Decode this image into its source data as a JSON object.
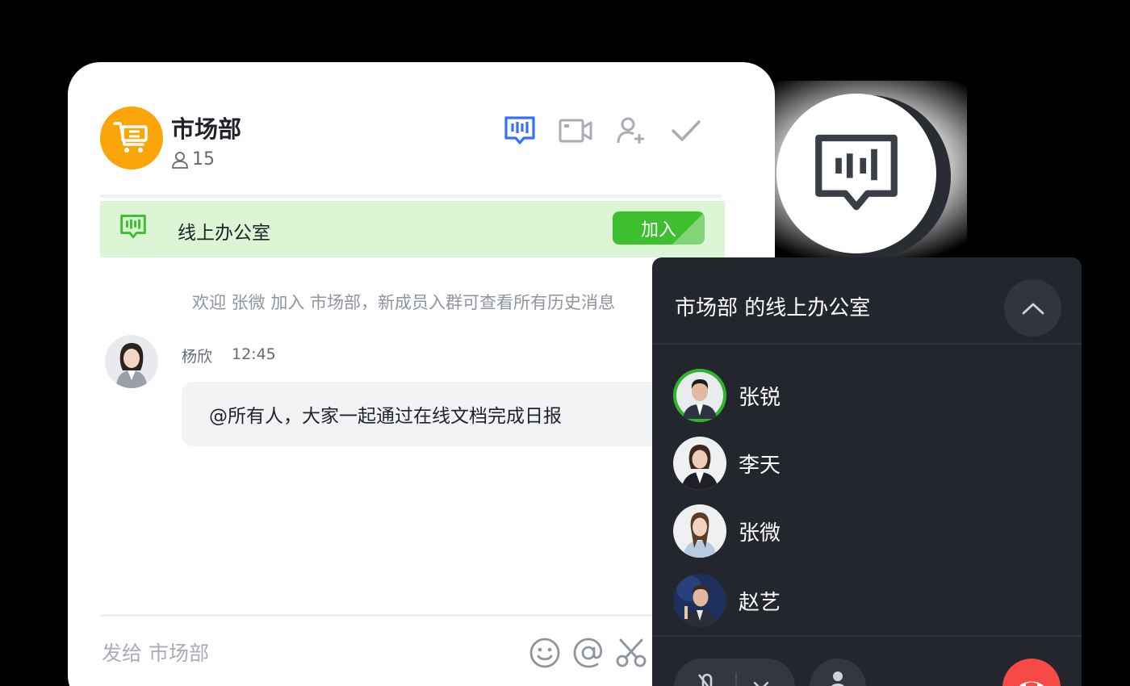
{
  "group": {
    "name": "市场部",
    "member_count": "15",
    "icon": "shopping-cart-icon",
    "avatar_color": "#FAA50A"
  },
  "header_actions": [
    {
      "icon": "online-office-icon",
      "active": true
    },
    {
      "icon": "video-camera-icon"
    },
    {
      "icon": "add-member-icon"
    },
    {
      "icon": "checkmark-icon"
    }
  ],
  "office_banner": {
    "label": "线上办公室",
    "join_label": "加入",
    "icon": "online-office-icon"
  },
  "messages": {
    "system": "欢迎 张微 加入 市场部，新成员入群可查看所有历史消息",
    "sender": "杨欣",
    "time": "12:45",
    "text": "@所有人，大家一起通过在线文档完成日报"
  },
  "composer": {
    "placeholder": "发给 市场部",
    "tools": [
      "emoji-icon",
      "mention-icon",
      "scissors-icon"
    ]
  },
  "office_panel": {
    "title": "市场部 的线上办公室",
    "members": [
      {
        "name": "张锐",
        "speaking": true
      },
      {
        "name": "李天"
      },
      {
        "name": "张微"
      },
      {
        "name": "赵艺"
      }
    ]
  },
  "colors": {
    "accent_blue": "#3370FF",
    "success_green": "#3EBF30",
    "banner_bg": "#DBF5D5",
    "panel_bg": "#23262C",
    "hangup_red": "#F54A45"
  }
}
